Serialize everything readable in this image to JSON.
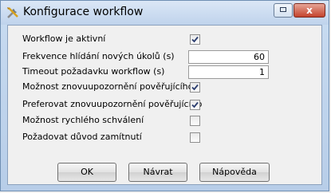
{
  "window": {
    "title": "Konfigurace workflow"
  },
  "title_buttons": {
    "close": "x"
  },
  "settings": [
    {
      "label": "Workflow je aktivní",
      "type": "checkbox",
      "checked": true
    },
    {
      "label": "Frekvence hlídání nových úkolů (s)",
      "type": "number",
      "value": "60"
    },
    {
      "label": "Timeout požadavku workflow (s)",
      "type": "number",
      "value": "1"
    },
    {
      "label": "Možnost znovuupozornění pověřujícího",
      "type": "checkbox",
      "checked": true
    },
    {
      "label": "Preferovat znovuupozornění pověřujícího",
      "type": "checkbox",
      "checked": true
    },
    {
      "label": "Možnost rychlého schválení",
      "type": "checkbox",
      "checked": false
    },
    {
      "label": "Požadovat důvod zamítnutí",
      "type": "checkbox",
      "checked": false
    }
  ],
  "buttons": {
    "ok": "OK",
    "back": "Návrat",
    "help": "Nápověda"
  }
}
